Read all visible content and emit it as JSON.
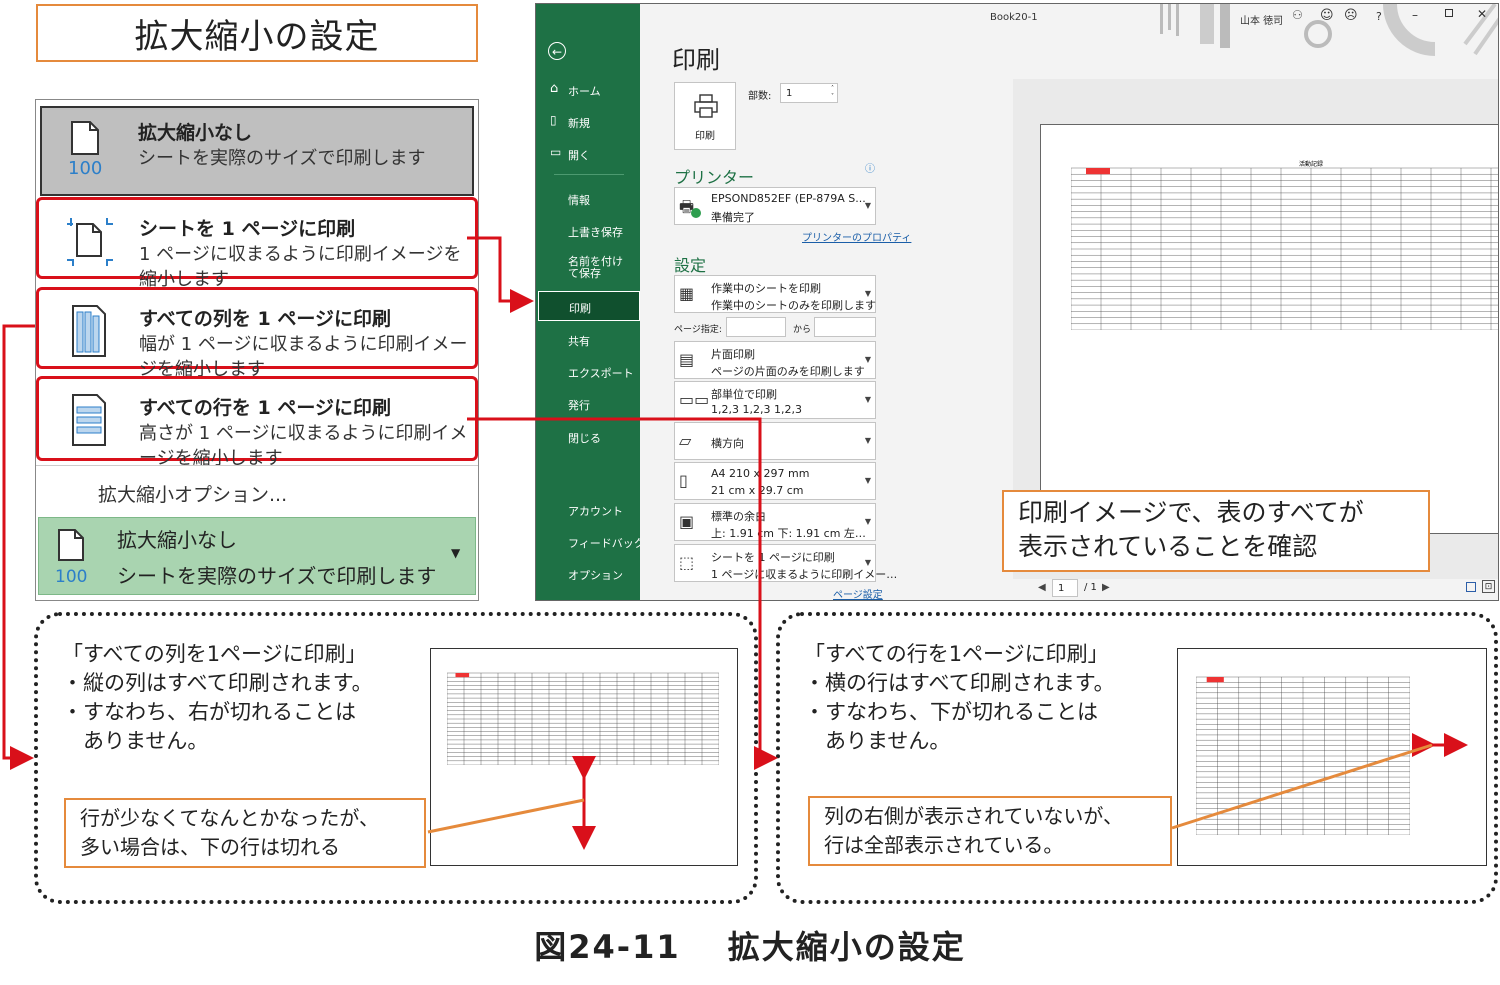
{
  "title": "拡大縮小の設定",
  "scale_menu": {
    "options": [
      {
        "title": "拡大縮小なし",
        "desc": "シートを実際のサイズで印刷します",
        "icon": "page-100-icon"
      },
      {
        "title": "シートを 1 ページに印刷",
        "desc": "1 ページに収まるように印刷イメージを縮小します",
        "icon": "fit-sheet-icon"
      },
      {
        "title": "すべての列を 1 ページに印刷",
        "desc": "幅が 1 ページに収まるように印刷イメージを縮小します",
        "icon": "fit-columns-icon"
      },
      {
        "title": "すべての行を 1 ページに印刷",
        "desc": "高さが 1 ページに収まるように印刷イメージを縮小します",
        "icon": "fit-rows-icon"
      }
    ],
    "options_link": "拡大縮小オプション...",
    "current": {
      "title": "拡大縮小なし",
      "desc": "シートを実際のサイズで印刷します",
      "icon_label": "100"
    },
    "icon_label": "100"
  },
  "excel": {
    "window_title": "Book20-1",
    "user_name": "山本 徳司",
    "nav": [
      "ホーム",
      "新規",
      "開く",
      "情報",
      "上書き保存",
      "名前を付けて保存",
      "印刷",
      "共有",
      "エクスポート",
      "発行",
      "閉じる",
      "アカウント",
      "フィードバック",
      "オプション"
    ],
    "heading": "印刷",
    "print_button": "印刷",
    "copies_label": "部数:",
    "copies_value": "1",
    "printer_heading": "プリンター",
    "printer_name": "EPSOND852EF (EP-879A S...",
    "printer_status": "準備完了",
    "printer_props": "プリンターのプロパティ",
    "settings_heading": "設定",
    "settings": [
      {
        "t1": "作業中のシートを印刷",
        "t2": "作業中のシートのみを印刷します"
      },
      {
        "t1": "片面印刷",
        "t2": "ページの片面のみを印刷します"
      },
      {
        "t1": "部単位で印刷",
        "t2": "1,2,3    1,2,3    1,2,3"
      },
      {
        "t1": "横方向",
        "t2": ""
      },
      {
        "t1": "A4 210 x 297 mm",
        "t2": "21 cm x 29.7 cm"
      },
      {
        "t1": "標準の余白",
        "t2": "上: 1.91 cm 下: 1.91 cm 左…"
      },
      {
        "t1": "シートを 1 ページに印刷",
        "t2": "1 ページに収まるように印刷イメー…"
      }
    ],
    "pages_label": "ページ指定:",
    "pages_to": "から",
    "page_setup_link": "ページ設定",
    "page_current": "1",
    "page_total": "/ 1",
    "sheet_title": "活動記録"
  },
  "preview_callout": [
    "印刷イメージで、表のすべてが",
    "表示されていることを確認"
  ],
  "cols_section": {
    "lines": [
      "「すべての列を1ページに印刷」",
      "・縦の列はすべて印刷されます。",
      "・すなわち、右が切れることは",
      "　ありません。"
    ],
    "callout": [
      "行が少なくてなんとかなったが、",
      "多い場合は、下の行は切れる"
    ]
  },
  "rows_section": {
    "lines": [
      "「すべての行を1ページに印刷」",
      "・横の行はすべて印刷されます。",
      "・すなわち、下が切れることは",
      "　ありません。"
    ],
    "callout": [
      "列の右側が表示されていないが、",
      "行は全部表示されている。"
    ]
  },
  "caption": "図24-11　 拡大縮小の設定",
  "colors": {
    "excel_green": "#1e7145",
    "highlight_red": "#d9101a",
    "callout_orange": "#e58a3c",
    "selected_green": "#a9d4b0"
  }
}
